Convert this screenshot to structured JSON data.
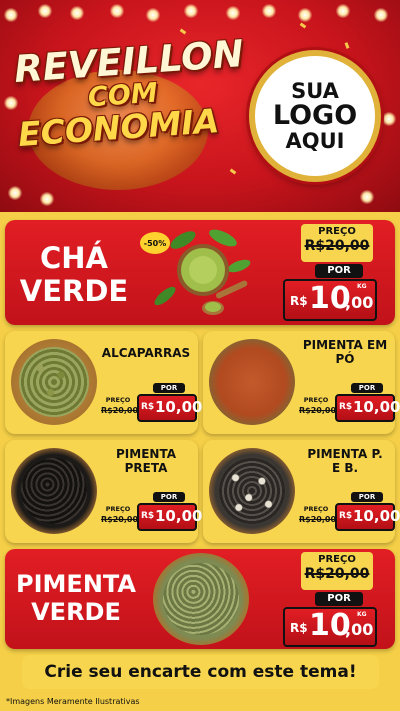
{
  "header": {
    "title_line1": "REVEILLON",
    "title_line2": "COM",
    "title_line3": "ECONOMIA",
    "logo_line1": "SUA",
    "logo_line2": "LOGO",
    "logo_line3": "AQUI"
  },
  "featured_top": {
    "name_line1": "CHÁ",
    "name_line2": "VERDE",
    "discount": "-50%",
    "preco_label": "PREÇO",
    "old_price": "R$20,00",
    "por_label": "POR",
    "currency": "R$",
    "price_int": "10",
    "price_dec": ",00",
    "unit": "KG"
  },
  "products": [
    {
      "name_line1": "ALCAPARRAS",
      "name_line2": "",
      "preco_label": "PREÇO",
      "old_price": "R$20,00",
      "por_label": "POR",
      "currency": "R$",
      "price": "10,00",
      "unit": "KG"
    },
    {
      "name_line1": "PIMENTA EM",
      "name_line2": "PÓ",
      "preco_label": "PREÇO",
      "old_price": "R$20,00",
      "por_label": "POR",
      "currency": "R$",
      "price": "10,00",
      "unit": "KG"
    },
    {
      "name_line1": "PIMENTA",
      "name_line2": "PRETA",
      "preco_label": "PREÇO",
      "old_price": "R$20,00",
      "por_label": "POR",
      "currency": "R$",
      "price": "10,00",
      "unit": "KG"
    },
    {
      "name_line1": "PIMENTA P.",
      "name_line2": "E B.",
      "preco_label": "PREÇO",
      "old_price": "R$20,00",
      "por_label": "POR",
      "currency": "R$",
      "price": "10,00",
      "unit": "KG"
    }
  ],
  "featured_bottom": {
    "name_line1": "PIMENTA",
    "name_line2": "VERDE",
    "preco_label": "PREÇO",
    "old_price": "R$20,00",
    "por_label": "POR",
    "currency": "R$",
    "price_int": "10",
    "price_dec": ",00",
    "unit": "KG"
  },
  "cta": "Crie seu encarte com este tema!",
  "disclaimer": "*Imagens Meramente Ilustrativas",
  "colors": {
    "red": "#d6181f",
    "yellow": "#f7d54e",
    "gold": "#ffd84a"
  }
}
